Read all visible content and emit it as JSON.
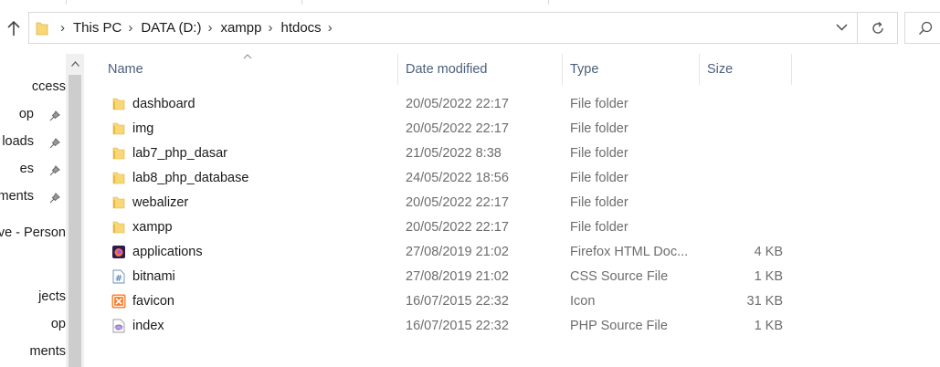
{
  "address": {
    "crumbs": [
      "This PC",
      "DATA (D:)",
      "xampp",
      "htdocs"
    ],
    "separator": "›"
  },
  "nav": {
    "items": [
      {
        "label": "ccess",
        "pinned": false
      },
      {
        "label": "op",
        "pinned": true
      },
      {
        "label": "loads",
        "pinned": true
      },
      {
        "label": "es",
        "pinned": true
      },
      {
        "label": "ments",
        "pinned": true
      },
      {
        "label": "ve - Person",
        "pinned": false
      },
      {
        "label": "",
        "pinned": false
      },
      {
        "label": "jects",
        "pinned": false
      },
      {
        "label": "op",
        "pinned": false
      },
      {
        "label": "ments",
        "pinned": false
      }
    ]
  },
  "columns": {
    "name": "Name",
    "date": "Date modified",
    "type": "Type",
    "size": "Size"
  },
  "files": [
    {
      "name": "dashboard",
      "date": "20/05/2022 22:17",
      "type": "File folder",
      "size": "",
      "icon": "folder-icon"
    },
    {
      "name": "img",
      "date": "20/05/2022 22:17",
      "type": "File folder",
      "size": "",
      "icon": "folder-icon"
    },
    {
      "name": "lab7_php_dasar",
      "date": "21/05/2022 8:38",
      "type": "File folder",
      "size": "",
      "icon": "folder-icon"
    },
    {
      "name": "lab8_php_database",
      "date": "24/05/2022 18:56",
      "type": "File folder",
      "size": "",
      "icon": "folder-icon"
    },
    {
      "name": "webalizer",
      "date": "20/05/2022 22:17",
      "type": "File folder",
      "size": "",
      "icon": "folder-icon"
    },
    {
      "name": "xampp",
      "date": "20/05/2022 22:17",
      "type": "File folder",
      "size": "",
      "icon": "folder-icon"
    },
    {
      "name": "applications",
      "date": "27/08/2019 21:02",
      "type": "Firefox HTML Doc...",
      "size": "4 KB",
      "icon": "firefox-html-icon"
    },
    {
      "name": "bitnami",
      "date": "27/08/2019 21:02",
      "type": "CSS Source File",
      "size": "1 KB",
      "icon": "css-file-icon"
    },
    {
      "name": "favicon",
      "date": "16/07/2015 22:32",
      "type": "Icon",
      "size": "31 KB",
      "icon": "xampp-icon"
    },
    {
      "name": "index",
      "date": "16/07/2015 22:32",
      "type": "PHP Source File",
      "size": "1 KB",
      "icon": "php-file-icon"
    }
  ],
  "colors": {
    "folder": "#f8d775",
    "folder_dark": "#e8b73e",
    "header_text": "#4c607a",
    "secondary_text": "#6d6d6d",
    "xampp": "#fb7a24"
  }
}
